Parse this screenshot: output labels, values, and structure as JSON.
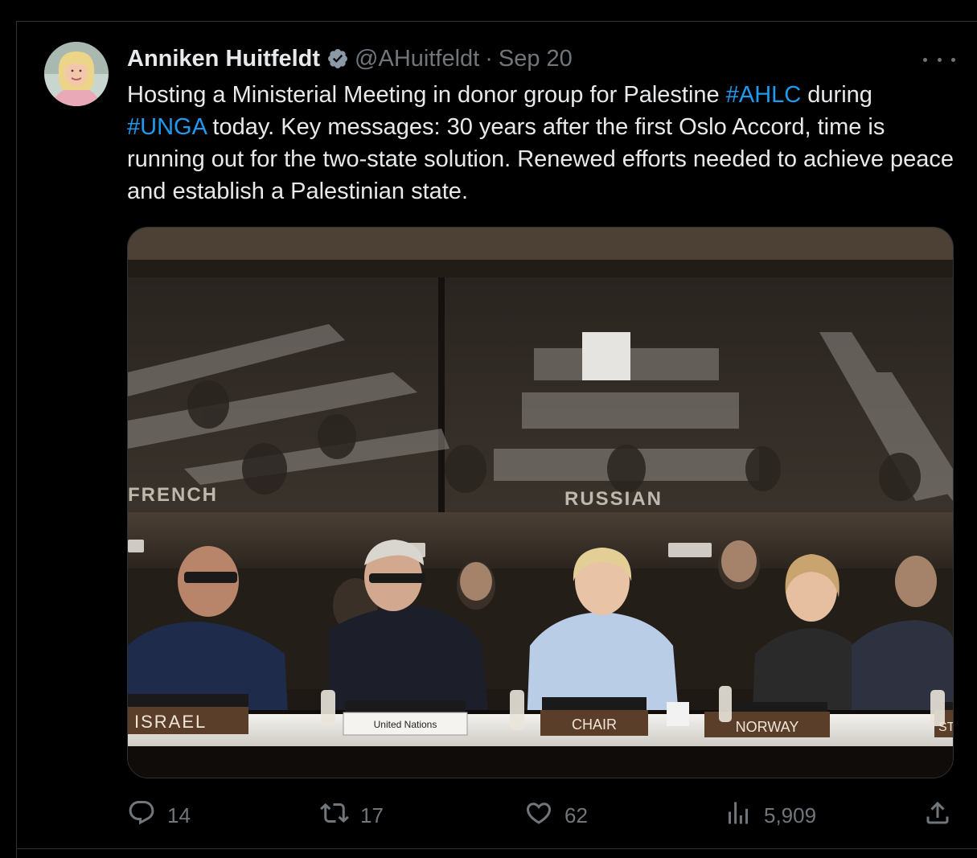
{
  "author": {
    "name": "Anniken Huitfeldt",
    "handle": "@AHuitfeldt",
    "separator": "·",
    "date": "Sep 20"
  },
  "tweet": {
    "text_1": "Hosting a Ministerial Meeting in donor group for Palestine ",
    "hashtag_1": "#AHLC",
    "text_2": " during ",
    "hashtag_2": "#UNGA",
    "text_3": " today. Key messages: 30 years after the first Oslo Accord, time is running out for the two-state solution. Renewed efforts needed to achieve peace and establish a Palestinian state."
  },
  "image": {
    "booth_labels": [
      "FRENCH",
      "RUSSIAN"
    ],
    "nameplates": [
      "ISRAEL",
      "United Nations",
      "CHAIR",
      "NORWAY",
      "ST"
    ]
  },
  "metrics": {
    "replies": "14",
    "reposts": "17",
    "likes": "62",
    "views": "5,909"
  },
  "icons": [
    "verified-badge-icon",
    "more-icon",
    "reply-icon",
    "repost-icon",
    "like-icon",
    "views-icon",
    "share-icon"
  ],
  "colors": {
    "background": "#000000",
    "text": "#e7e9ea",
    "secondary": "#71767b",
    "accent": "#1d9bf0",
    "border": "#2f3336"
  }
}
